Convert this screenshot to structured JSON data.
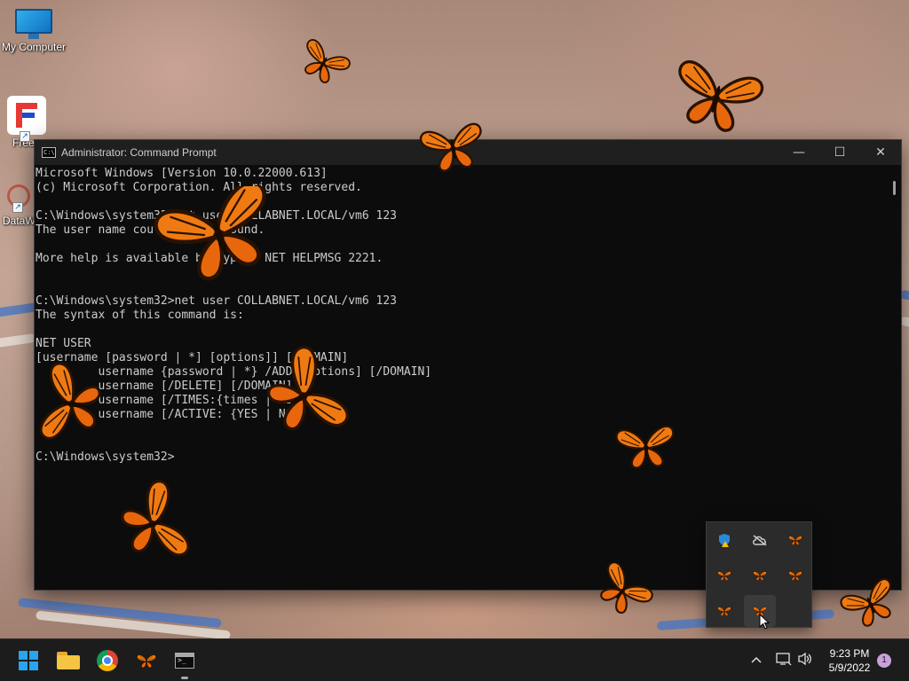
{
  "desktop": {
    "icons": [
      {
        "label": "My Computer"
      },
      {
        "label": "Free"
      },
      {
        "label": "DataW"
      }
    ]
  },
  "window": {
    "title": "Administrator: Command Prompt",
    "app_icon_text": "C:\\",
    "buttons": {
      "minimize": "—",
      "maximize": "☐",
      "close": "✕"
    },
    "console_lines": [
      "Microsoft Windows [Version 10.0.22000.613]",
      "(c) Microsoft Corporation. All rights reserved.",
      "",
      "C:\\Windows\\system32>net user COLLABNET.LOCAL/vm6 123",
      "The user name could not be found.",
      "",
      "More help is available by typing NET HELPMSG 2221.",
      "",
      "",
      "C:\\Windows\\system32>net user COLLABNET.LOCAL/vm6 123",
      "The syntax of this command is:",
      "",
      "NET USER",
      "[username [password | *] [options]] [/DOMAIN]",
      "         username {password | *} /ADD [options] [/DOMAIN]",
      "         username [/DELETE] [/DOMAIN]",
      "         username [/TIMES:{times | ALL}]",
      "         username [/ACTIVE: {YES | NO}]",
      "",
      "",
      "C:\\Windows\\system32>"
    ]
  },
  "taskbar": {
    "items": [
      "start-button",
      "file-explorer",
      "chrome",
      "butterfly-app",
      "command-prompt"
    ],
    "tray": {
      "chevron": "^",
      "time": "9:23 PM",
      "date": "5/9/2022",
      "notification_count": "1"
    }
  },
  "tray_flyout": {
    "icons": [
      "defender-warning-icon",
      "onedrive-offline-icon",
      "butterfly-icon",
      "butterfly-icon",
      "butterfly-icon",
      "butterfly-icon",
      "butterfly-icon",
      "butterfly-icon"
    ]
  },
  "colors": {
    "console_bg": "#0c0c0c",
    "console_text": "#cccccc",
    "taskbar_bg": "#1c1c1c",
    "butterfly_orange": "#f07a12"
  }
}
